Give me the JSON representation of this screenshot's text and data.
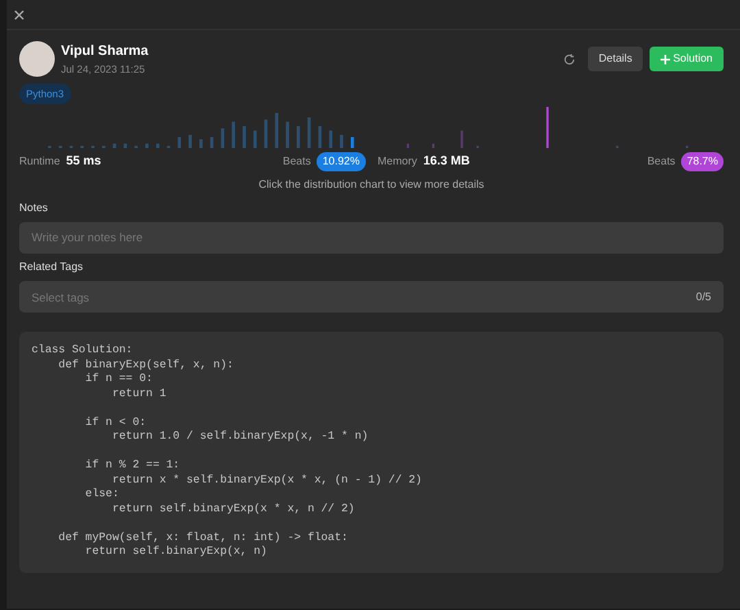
{
  "author": {
    "name": "Vipul Sharma",
    "date": "Jul 24, 2023 11:25"
  },
  "actions": {
    "details": "Details",
    "solution": "Solution"
  },
  "language_tag": "Python3",
  "stats": [
    {
      "label": "Runtime",
      "value": "55 ms",
      "beats_label": "Beats",
      "beats": "10.92%",
      "color": "#1a7fe0"
    },
    {
      "label": "Memory",
      "value": "16.3 MB",
      "beats_label": "Beats",
      "beats": "78.7%",
      "color": "#b045d8"
    }
  ],
  "hint": "Click the distribution chart to view more details",
  "notes": {
    "label": "Notes",
    "placeholder": "Write your notes here"
  },
  "related_tags": {
    "label": "Related Tags",
    "placeholder": "Select tags",
    "count": "0/5"
  },
  "code_blocks": [
    [
      "class Solution:",
      "    def binaryExp(self, x, n):",
      "        if n == 0:",
      "            return 1"
    ],
    [
      "        if n < 0:",
      "            return 1.0 / self.binaryExp(x, -1 * n)"
    ],
    [
      "        if n % 2 == 1:",
      "            return x * self.binaryExp(x * x, (n - 1) // 2)",
      "        else:",
      "            return self.binaryExp(x * x, n // 2)"
    ],
    [
      "    def myPow(self, x: float, n: int) -> float:",
      "        return self.binaryExp(x, n)"
    ]
  ]
}
